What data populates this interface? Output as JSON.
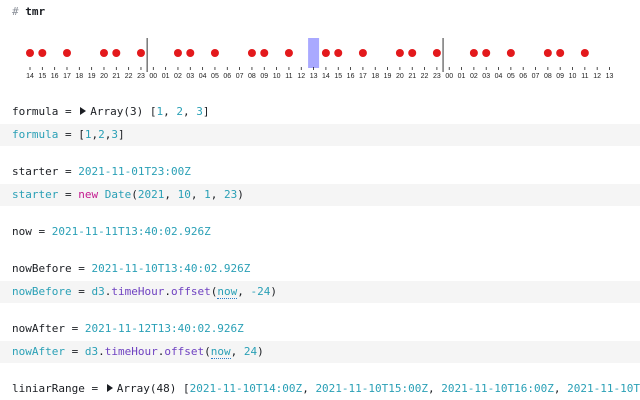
{
  "notebook": {
    "title_hash": "#",
    "title": "tmr"
  },
  "timeline": {
    "labels": [
      "14",
      "15",
      "16",
      "17",
      "18",
      "19",
      "20",
      "21",
      "22",
      "23",
      "00",
      "01",
      "02",
      "03",
      "04",
      "05",
      "06",
      "07",
      "08",
      "09",
      "10",
      "11",
      "12",
      "13",
      "14",
      "15",
      "16",
      "17",
      "18",
      "19",
      "20",
      "21",
      "22",
      "23",
      "00",
      "01",
      "02",
      "03",
      "04",
      "05",
      "06",
      "07",
      "08",
      "09",
      "10",
      "11",
      "12",
      "13"
    ],
    "dots": [
      0,
      1,
      3,
      6,
      7,
      9,
      12,
      13,
      15,
      18,
      19,
      21,
      24,
      25,
      27,
      30,
      31,
      33,
      36,
      37,
      39,
      42,
      43,
      45
    ],
    "dividers": [
      10,
      34
    ],
    "highlight": 23,
    "colors": {
      "dot": "#e3191c",
      "highlight": "#a9a9ff",
      "divider": "#333333",
      "tick": "#222222"
    }
  },
  "cells": {
    "formula_out": {
      "name": "formula",
      "eq": " = ",
      "prefix": "Array(3) [",
      "v1": "1",
      "c1": ", ",
      "v2": "2",
      "c2": ", ",
      "v3": "3",
      "suffix": "]"
    },
    "formula_src": {
      "name": "formula",
      "eq": " = [",
      "v1": "1",
      "c1": ",",
      "v2": "2",
      "c2": ",",
      "v3": "3",
      "suffix": "]"
    },
    "starter_out": {
      "name": "starter",
      "eq": " = ",
      "value": "2021-11-01T23:00Z"
    },
    "starter_src": {
      "name": "starter",
      "eq": " = ",
      "kw": "new",
      "space": " ",
      "ctor": "Date",
      "open": "(",
      "a1": "2021",
      "c1": ", ",
      "a2": "10",
      "c2": ", ",
      "a3": "1",
      "c3": ", ",
      "a4": "23",
      "close": ")"
    },
    "now_out": {
      "name": "now",
      "eq": " = ",
      "value": "2021-11-11T13:40:02.926Z"
    },
    "nowbefore_out": {
      "name": "nowBefore",
      "eq": " = ",
      "value": "2021-11-10T13:40:02.926Z"
    },
    "nowbefore_src": {
      "name": "nowBefore",
      "eq": " = ",
      "obj": "d3",
      "dot1": ".",
      "p1": "timeHour",
      "dot2": ".",
      "p2": "offset",
      "open": "(",
      "arg": "now",
      "comma": ", ",
      "num": "-24",
      "close": ")"
    },
    "nowafter_out": {
      "name": "nowAfter",
      "eq": " = ",
      "value": "2021-11-12T13:40:02.926Z"
    },
    "nowafter_src": {
      "name": "nowAfter",
      "eq": " = ",
      "obj": "d3",
      "dot1": ".",
      "p1": "timeHour",
      "dot2": ".",
      "p2": "offset",
      "open": "(",
      "arg": "now",
      "comma": ", ",
      "num": "24",
      "close": ")"
    },
    "range_out": {
      "name": "liniarRange",
      "eq": " = ",
      "prefix": "Array(48) [",
      "v1": "2021-11-10T14:00Z",
      "c1": ", ",
      "v2": "2021-11-10T15:00Z",
      "c2": ", ",
      "v3": "2021-11-10T16:00Z",
      "c3": ", ",
      "v4": "2021-11-10T17"
    }
  }
}
